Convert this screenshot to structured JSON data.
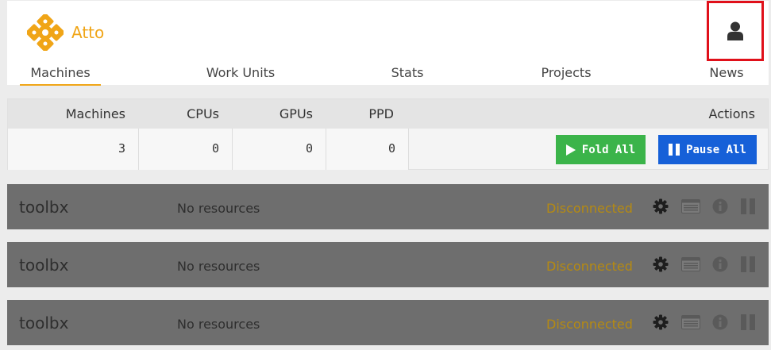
{
  "app": {
    "brand": "Atto",
    "brand_color": "#f0a517"
  },
  "account": {
    "icon": "user-icon"
  },
  "nav": {
    "tabs": [
      {
        "label": "Machines",
        "active": true
      },
      {
        "label": "Work Units",
        "active": false
      },
      {
        "label": "Stats",
        "active": false
      },
      {
        "label": "Projects",
        "active": false
      },
      {
        "label": "News",
        "active": false
      }
    ]
  },
  "summary": {
    "headers": {
      "machines": "Machines",
      "cpus": "CPUs",
      "gpus": "GPUs",
      "ppd": "PPD",
      "actions": "Actions"
    },
    "values": {
      "machines": "3",
      "cpus": "0",
      "gpus": "0",
      "ppd": "0"
    },
    "fold_all_label": "Fold All",
    "pause_all_label": "Pause All"
  },
  "machines": [
    {
      "name": "toolbx",
      "resources": "No resources",
      "status": "Disconnected"
    },
    {
      "name": "toolbx",
      "resources": "No resources",
      "status": "Disconnected"
    },
    {
      "name": "toolbx",
      "resources": "No resources",
      "status": "Disconnected"
    }
  ],
  "colors": {
    "fold_button": "#3bb44a",
    "pause_button": "#1660d8",
    "disconnected": "#b58a12",
    "account_highlight": "#e0101a"
  }
}
